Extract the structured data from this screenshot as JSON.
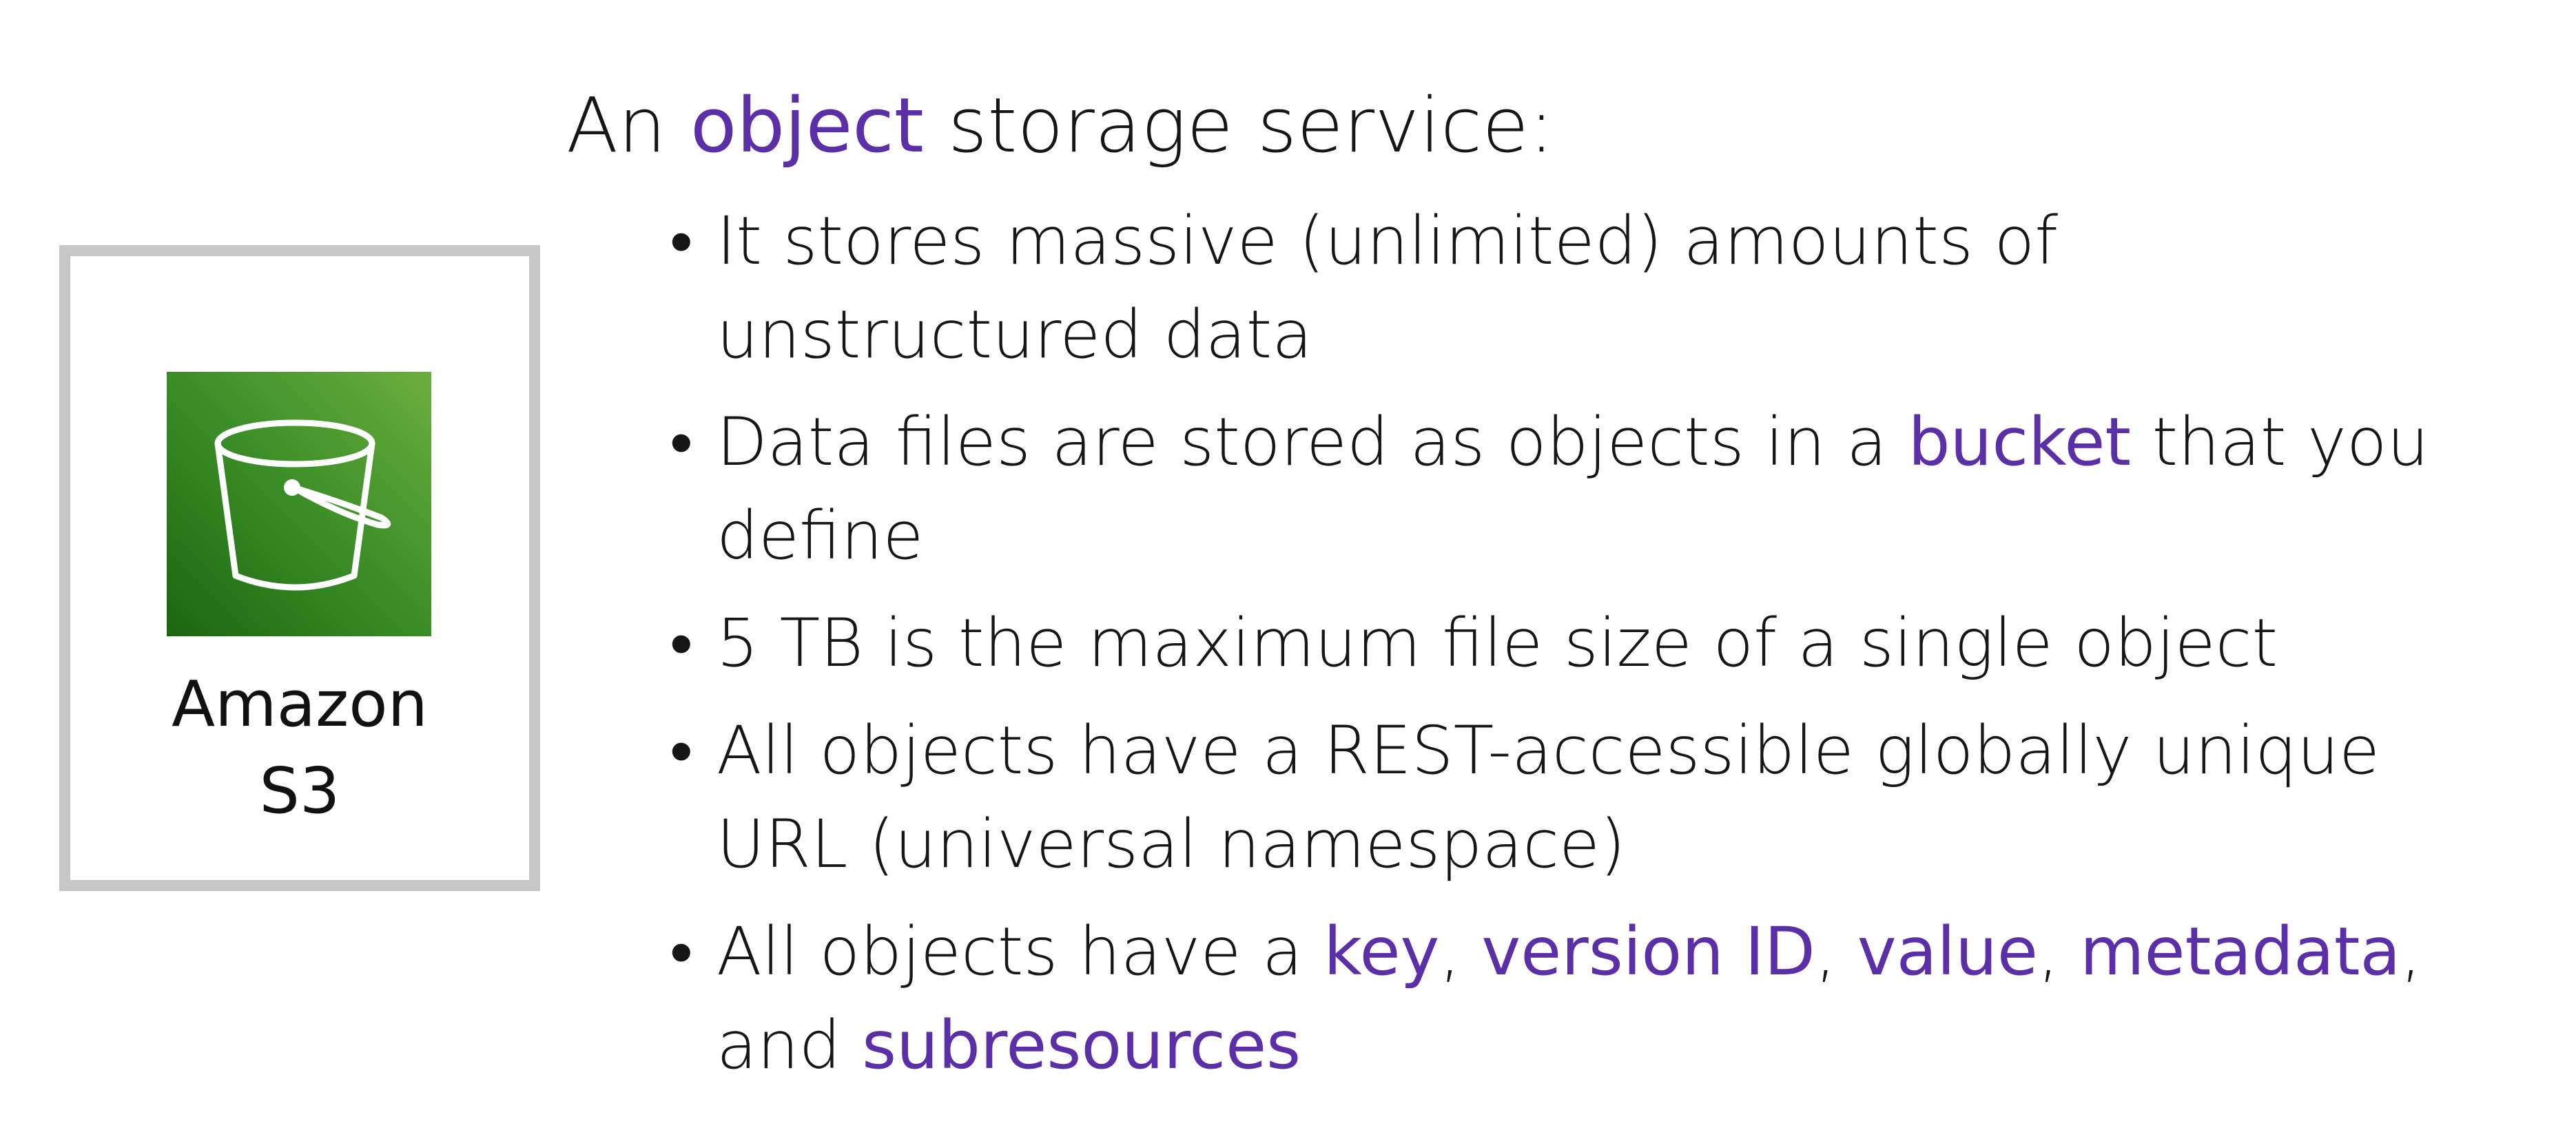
{
  "service": {
    "name_line1": "Amazon",
    "name_line2": "S3",
    "logo_icon": "s3-bucket-icon",
    "logo_colors": [
      "#1b660f",
      "#6cae3e"
    ],
    "card_border_color": "#c6c6c6"
  },
  "accent_color": "#5a2fa8",
  "heading": {
    "part1": "An ",
    "highlight": "object",
    "part2": " storage service:"
  },
  "bullets": [
    {
      "line1": "It stores massive (unlimited) amounts of",
      "line2": "unstructured data"
    },
    {
      "line1_a": "Data files are stored as objects in a ",
      "line1_highlight": "bucket",
      "line1_b": " that you",
      "line2": "define"
    },
    {
      "line1": "5 TB is the maximum file size of a single object"
    },
    {
      "line1": "All objects have a REST-accessible globally unique",
      "line2": "URL (universal namespace)"
    },
    {
      "line1_a": "All objects have a ",
      "hl_key": "key",
      "sep1": ", ",
      "hl_version": "version ID",
      "sep2": ", ",
      "hl_value": "value",
      "sep3": ", ",
      "hl_metadata": "metadata",
      "sep4": ",",
      "line2_a": "and ",
      "hl_subresources": "subresources"
    }
  ]
}
